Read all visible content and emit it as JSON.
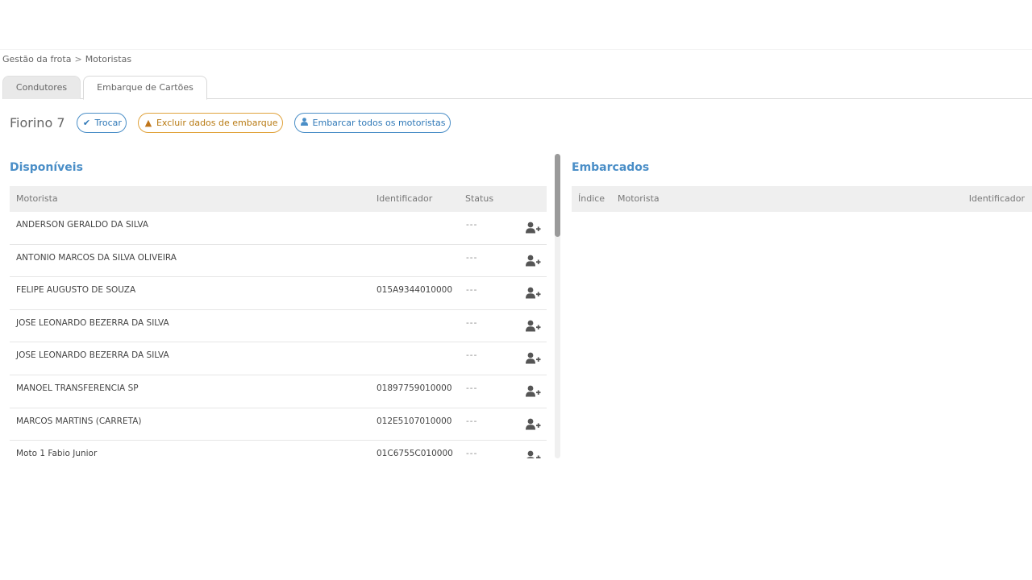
{
  "breadcrumb": {
    "parent": "Gestão da frota",
    "separator": ">",
    "current": "Motoristas"
  },
  "tabs": [
    {
      "label": "Condutores",
      "active": false
    },
    {
      "label": "Embarque de Cartões",
      "active": true
    }
  ],
  "vehicle": {
    "name": "Fiorino 7",
    "buttons": {
      "trocar": "Trocar",
      "excluir": "Excluir dados de embarque",
      "embarcar_todos": "Embarcar todos os motoristas"
    }
  },
  "available": {
    "title": "Disponíveis",
    "columns": {
      "motorista": "Motorista",
      "identificador": "Identificador",
      "status": "Status"
    },
    "rows": [
      {
        "motorista": "ANDERSON GERALDO DA SILVA",
        "identificador": "",
        "status": "---"
      },
      {
        "motorista": "ANTONIO MARCOS DA SILVA OLIVEIRA",
        "identificador": "",
        "status": "---"
      },
      {
        "motorista": "FELIPE AUGUSTO DE SOUZA",
        "identificador": "015A9344010000",
        "status": "---"
      },
      {
        "motorista": "JOSE LEONARDO BEZERRA DA SILVA",
        "identificador": "",
        "status": "---"
      },
      {
        "motorista": "JOSE LEONARDO BEZERRA DA SILVA",
        "identificador": "",
        "status": "---"
      },
      {
        "motorista": "MANOEL TRANSFERENCIA SP",
        "identificador": "01897759010000",
        "status": "---"
      },
      {
        "motorista": "MARCOS MARTINS (CARRETA)",
        "identificador": "012E5107010000",
        "status": "---"
      },
      {
        "motorista": "Moto 1 Fabio Junior",
        "identificador": "01C6755C010000",
        "status": "---"
      }
    ]
  },
  "embarked": {
    "title": "Embarcados",
    "columns": {
      "indice": "Índice",
      "motorista": "Motorista",
      "identificador": "Identificador"
    }
  },
  "colors": {
    "accent": "#4a8ec7",
    "warning": "#e0a23b",
    "header_bg": "#efefef"
  },
  "icons": {
    "trocar": "check-icon",
    "excluir": "warning-triangle-icon",
    "embarcar": "user-icon",
    "row_action": "user-plus-icon"
  }
}
